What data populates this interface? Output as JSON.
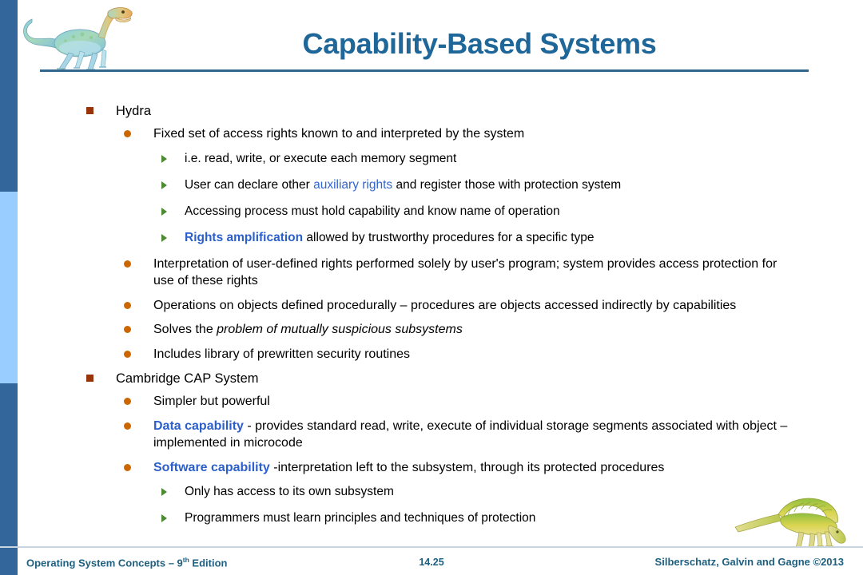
{
  "slide": {
    "title": "Capability-Based Systems",
    "page_number": "14.25",
    "accent_color": "#1F6699",
    "rule_color": "#33668C",
    "rail_dark_color": "#33669A",
    "rail_light_color": "#99CCFF",
    "level1_marker_color": "#99330A",
    "level2_marker_color": "#CC6600",
    "level3_marker_color": "#4C8A33",
    "highlight_color": "#3366CC"
  },
  "decor": {
    "top_left_dinosaur": "dinosaur-icon",
    "bottom_right_dinosaur": "dinosaur-icon"
  },
  "bullets": [
    {
      "level": 1,
      "marker": "square-bullet-icon",
      "parts": [
        {
          "text": "Hydra",
          "style": "plain"
        }
      ]
    },
    {
      "level": 2,
      "marker": "disc-bullet-icon",
      "parts": [
        {
          "text": "Fixed set of access rights known to and interpreted by the system",
          "style": "plain"
        }
      ]
    },
    {
      "level": 3,
      "marker": "triangle-bullet-icon",
      "parts": [
        {
          "text": "i.e. read, write, or execute each memory segment",
          "style": "plain"
        }
      ]
    },
    {
      "level": 3,
      "marker": "triangle-bullet-icon",
      "parts": [
        {
          "text": "User can declare other ",
          "style": "plain"
        },
        {
          "text": "auxiliary rights",
          "style": "blue"
        },
        {
          "text": " and register those with protection system",
          "style": "plain"
        }
      ]
    },
    {
      "level": 3,
      "marker": "triangle-bullet-icon",
      "parts": [
        {
          "text": "Accessing process must hold capability and know name of operation",
          "style": "plain"
        }
      ]
    },
    {
      "level": 3,
      "marker": "triangle-bullet-icon",
      "parts": [
        {
          "text": "Rights amplification",
          "style": "blue-bold"
        },
        {
          "text": " allowed by trustworthy  procedures for a specific type",
          "style": "plain"
        }
      ]
    },
    {
      "level": 2,
      "marker": "disc-bullet-icon",
      "parts": [
        {
          "text": "Interpretation of user-defined rights performed solely by user's program; system provides access protection for use of these rights",
          "style": "plain"
        }
      ]
    },
    {
      "level": 2,
      "marker": "disc-bullet-icon",
      "parts": [
        {
          "text": "Operations on objects defined procedurally – procedures are objects accessed indirectly by capabilities",
          "style": "plain"
        }
      ]
    },
    {
      "level": 2,
      "marker": "disc-bullet-icon",
      "parts": [
        {
          "text": "Solves the ",
          "style": "plain"
        },
        {
          "text": "problem of mutually suspicious subsystems",
          "style": "italic"
        }
      ]
    },
    {
      "level": 2,
      "marker": "disc-bullet-icon",
      "parts": [
        {
          "text": "Includes library of prewritten security routines",
          "style": "plain"
        }
      ]
    },
    {
      "level": 1,
      "marker": "square-bullet-icon",
      "parts": [
        {
          "text": "Cambridge CAP System",
          "style": "plain"
        }
      ]
    },
    {
      "level": 2,
      "marker": "disc-bullet-icon",
      "parts": [
        {
          "text": "Simpler but powerful",
          "style": "plain"
        }
      ]
    },
    {
      "level": 2,
      "marker": "disc-bullet-icon",
      "parts": [
        {
          "text": "Data capability",
          "style": "blue-bold"
        },
        {
          "text": " - provides standard read, write, execute of individual storage segments associated with object – implemented in microcode",
          "style": "plain"
        }
      ]
    },
    {
      "level": 2,
      "marker": "disc-bullet-icon",
      "parts": [
        {
          "text": "Software capability",
          "style": "blue-bold"
        },
        {
          "text": " -interpretation left to the subsystem, through its protected procedures",
          "style": "plain"
        }
      ]
    },
    {
      "level": 3,
      "marker": "triangle-bullet-icon",
      "parts": [
        {
          "text": "Only has access to its own subsystem",
          "style": "plain"
        }
      ]
    },
    {
      "level": 3,
      "marker": "triangle-bullet-icon",
      "parts": [
        {
          "text": "Programmers must learn principles and techniques of protection",
          "style": "plain"
        }
      ]
    }
  ],
  "footer": {
    "left_main": "Operating System Concepts – 9",
    "left_sup": "th",
    "left_tail": " Edition",
    "page": "14.25",
    "right": "Silberschatz, Galvin and Gagne ©2013"
  }
}
